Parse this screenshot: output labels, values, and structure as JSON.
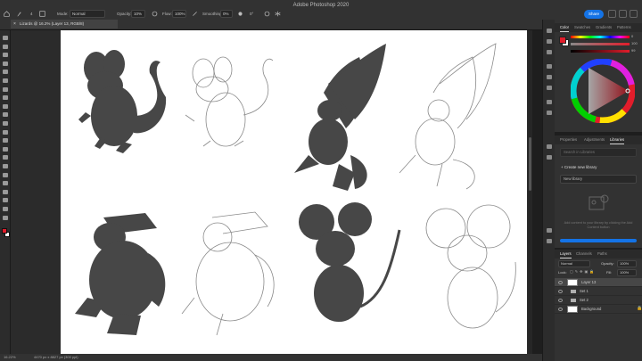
{
  "app": {
    "title": "Adobe Photoshop 2020"
  },
  "options": {
    "mode_label": "Mode:",
    "mode_value": "Normal",
    "opacity_label": "Opacity:",
    "opacity_value": "10%",
    "flow_label": "Flow:",
    "flow_value": "100%",
    "smoothing_label": "Smoothing:",
    "smoothing_value": "0%",
    "angle_value": "0°",
    "brush_size": "4",
    "share_label": "Share"
  },
  "document": {
    "tab_label": "Lizards @ 16.2% (Layer 13, RGB/8)"
  },
  "status": {
    "zoom": "16.22%",
    "info": "4470 px x 8827 px (300 ppi)"
  },
  "color_panel": {
    "tabs": [
      "Color",
      "Swatches",
      "Gradients",
      "Patterns"
    ],
    "active_tab": "Color",
    "slider_values": [
      "0",
      "100",
      "99"
    ],
    "foreground": "#e21d2b",
    "background": "#ffffff"
  },
  "properties_panel": {
    "tabs": [
      "Properties",
      "Adjustments",
      "Libraries"
    ],
    "active_tab": "Libraries",
    "search_placeholder": "Search in Libraries",
    "create_new": "Create new library",
    "library_select": "New library",
    "hint": "Add content to your library by clicking the Add Content button"
  },
  "layers_panel": {
    "tabs": [
      "Layers",
      "Channels",
      "Paths"
    ],
    "active_tab": "Layers",
    "blend_mode": "Normal",
    "opacity_label": "Opacity:",
    "opacity_value": "100%",
    "fill_label": "Fill:",
    "fill_value": "100%",
    "lock_label": "Lock:",
    "layers": [
      {
        "name": "Layer 13",
        "kind": "layer",
        "selected": true
      },
      {
        "name": "Set 1",
        "kind": "group",
        "selected": false
      },
      {
        "name": "Set 2",
        "kind": "group",
        "selected": false
      },
      {
        "name": "Background",
        "kind": "layer",
        "selected": false
      }
    ]
  },
  "icons": {
    "toolbar": [
      "move-icon",
      "marquee-icon",
      "lasso-icon",
      "quick-select-icon",
      "crop-icon",
      "frame-icon",
      "eyedropper-icon",
      "healing-icon",
      "brush-icon",
      "clone-stamp-icon",
      "history-brush-icon",
      "eraser-icon",
      "gradient-icon",
      "blur-icon",
      "dodge-icon",
      "pen-icon",
      "type-icon",
      "path-select-icon",
      "rectangle-icon",
      "hand-icon",
      "zoom-icon",
      "more-tools-icon"
    ]
  }
}
